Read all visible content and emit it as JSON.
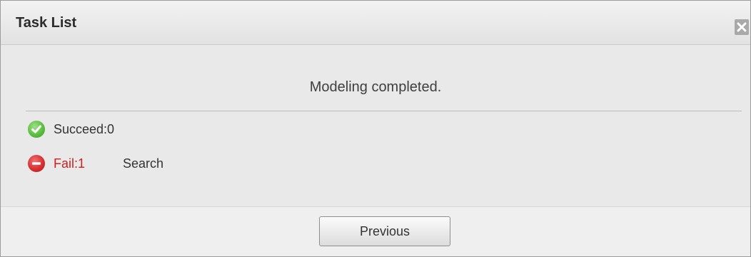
{
  "dialog": {
    "title": "Task List",
    "close_icon": "close-icon"
  },
  "content": {
    "message": "Modeling completed.",
    "succeed": {
      "label": "Succeed:0",
      "icon": "check-circle-icon",
      "color": "#5cbf3e"
    },
    "fail": {
      "label": "Fail:1",
      "icon": "minus-circle-icon",
      "color": "#cf2020",
      "task": "Search"
    }
  },
  "footer": {
    "previous_label": "Previous"
  }
}
